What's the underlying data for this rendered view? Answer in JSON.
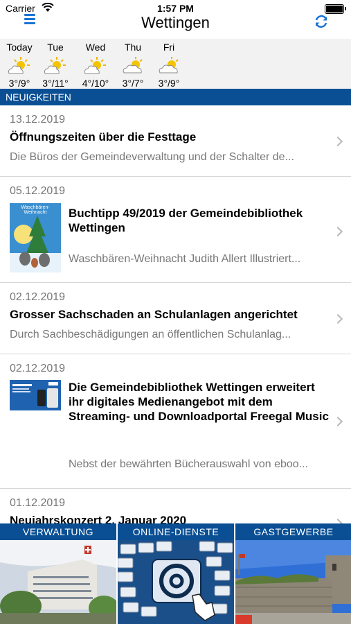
{
  "status_bar": {
    "carrier": "Carrier",
    "time": "1:57 PM"
  },
  "header": {
    "title": "Wettingen"
  },
  "weather": [
    {
      "day": "Today",
      "temp": "3°/9°",
      "icon": "sun-cloud-icon"
    },
    {
      "day": "Tue",
      "temp": "3°/11°",
      "icon": "sun-cloud-icon"
    },
    {
      "day": "Wed",
      "temp": "4°/10°",
      "icon": "sun-cloud-icon"
    },
    {
      "day": "Thu",
      "temp": "3°/7°",
      "icon": "cloud-sun-icon"
    },
    {
      "day": "Fri",
      "temp": "3°/9°",
      "icon": "cloud-sun-icon"
    }
  ],
  "section": {
    "title": "NEUIGKEITEN"
  },
  "news": [
    {
      "date": "13.12.2019",
      "title": "Öffnungszeiten über die Festtage",
      "snippet": "Die Büros der Gemeindeverwaltung und der Schalter de..."
    },
    {
      "date": "05.12.2019",
      "title": "Buchtipp 49/2019 der Gemeindebibliothek Wettingen",
      "snippet": "Waschbären-Weihnacht  Judith Allert Illustriert...",
      "thumb_title": "Waschbären-Weihnacht"
    },
    {
      "date": "02.12.2019",
      "title": "Grosser Sachschaden an Schulanlagen angerichtet",
      "snippet": "Durch Sachbeschädigungen an öffentlichen Schulanlag..."
    },
    {
      "date": "02.12.2019",
      "title": "Die Gemeindebibliothek Wettingen erweitert ihr digitales Medienangebot mit dem Streaming- und Downloadportal Freegal Music",
      "snippet": "Nebst der bewährten Bücherauswahl von eboo..."
    },
    {
      "date": "01.12.2019",
      "title": "Neujahrskonzert 2. Januar 2020"
    }
  ],
  "tiles": [
    {
      "label": "VERWALTUNG"
    },
    {
      "label": "ONLINE-DIENSTE"
    },
    {
      "label": "GASTGEWERBE"
    }
  ],
  "colors": {
    "accent": "#1a74d6",
    "bar": "#0a4f94",
    "weather_bg": "#f2f2f2"
  }
}
